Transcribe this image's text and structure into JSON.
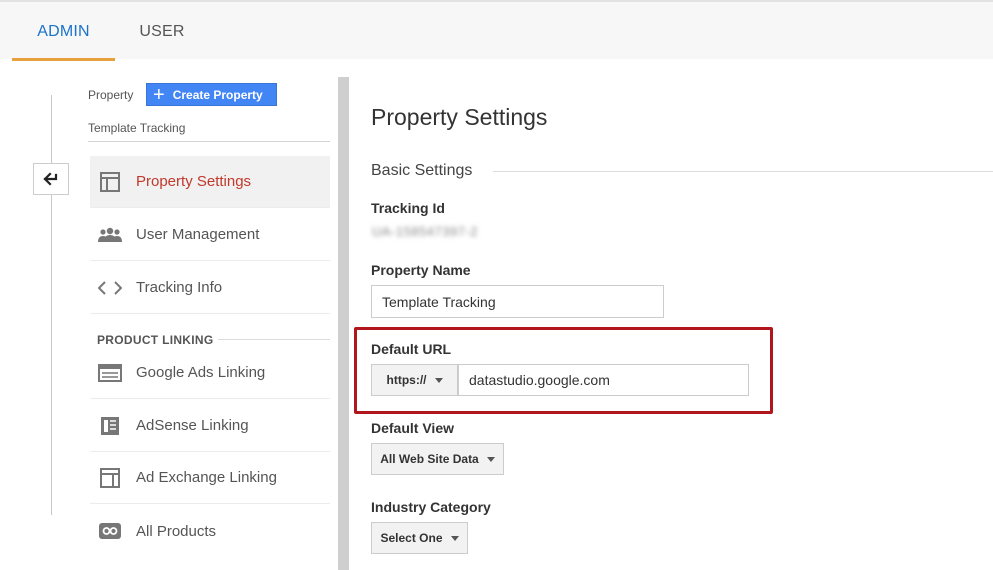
{
  "tabs": [
    {
      "label": "ADMIN",
      "active": true
    },
    {
      "label": "USER",
      "active": false
    }
  ],
  "sidebar": {
    "property_label": "Property",
    "create_button_label": "Create Property",
    "property_name": "Template Tracking",
    "items": [
      {
        "label": "Property Settings",
        "icon": "layout-icon",
        "active": true
      },
      {
        "label": "User Management",
        "icon": "people-icon",
        "active": false
      },
      {
        "label": "Tracking Info",
        "icon": "code-icon",
        "active": false
      }
    ],
    "product_linking_header": "PRODUCT LINKING",
    "linking_items": [
      {
        "label": "Google Ads Linking",
        "icon": "ads-icon"
      },
      {
        "label": "AdSense Linking",
        "icon": "adsense-icon"
      },
      {
        "label": "Ad Exchange Linking",
        "icon": "ad-exchange-icon"
      },
      {
        "label": "All Products",
        "icon": "link-icon"
      }
    ]
  },
  "main": {
    "title": "Property Settings",
    "section": "Basic Settings",
    "tracking_id_label": "Tracking Id",
    "tracking_id_value": "UA-158547397-2",
    "property_name_label": "Property Name",
    "property_name_value": "Template Tracking",
    "default_url_label": "Default URL",
    "protocol_value": "https://",
    "url_value": "datastudio.google.com",
    "default_view_label": "Default View",
    "default_view_value": "All Web Site Data",
    "industry_label": "Industry Category",
    "industry_value": "Select One"
  },
  "colors": {
    "accent_blue": "#1a73c8",
    "tab_underline": "#e8a03c",
    "active_item": "#c0392b",
    "highlight": "#b0161c",
    "button_blue": "#4285f4"
  }
}
